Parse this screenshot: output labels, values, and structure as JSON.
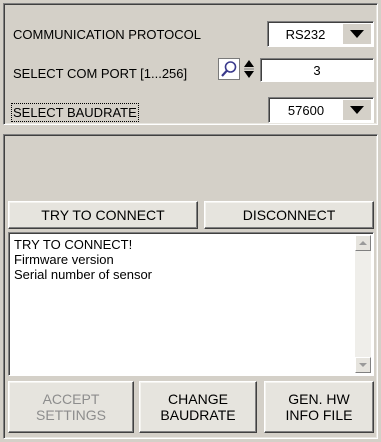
{
  "protocol": {
    "label": "COMMUNICATION PROTOCOL",
    "value": "RS232"
  },
  "com_port": {
    "label": "SELECT COM PORT [1...256]",
    "value": "3"
  },
  "baudrate": {
    "label": "SELECT BAUDRATE",
    "value": "57600"
  },
  "buttons": {
    "try_connect": "TRY TO CONNECT",
    "disconnect": "DISCONNECT",
    "accept_line1": "ACCEPT",
    "accept_line2": "SETTINGS",
    "change_line1": "CHANGE",
    "change_line2": "BAUDRATE",
    "genhw_line1": "GEN. HW",
    "genhw_line2": "INFO FILE"
  },
  "log": {
    "lines": [
      "TRY TO CONNECT!",
      "Firmware version",
      "Serial number of sensor"
    ]
  },
  "icons": {
    "search": "magnifier-icon",
    "spinner": "up-down-spinner-icon",
    "dropdown": "triangle-down-icon"
  },
  "colors": {
    "background": "#d4d0c8",
    "field": "#ffffff",
    "disabled_text": "#8d8d8d"
  }
}
